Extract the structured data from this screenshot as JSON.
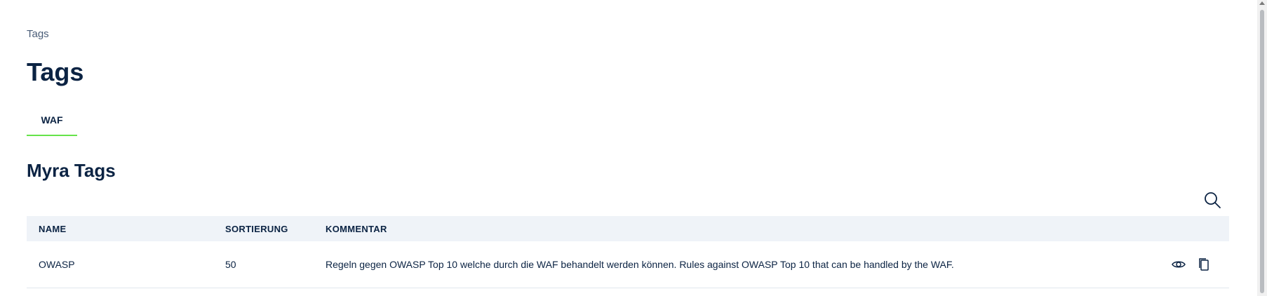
{
  "breadcrumb": "Tags",
  "page_title": "Tags",
  "tabs": [
    {
      "label": "WAF",
      "active": true
    }
  ],
  "section_title": "Myra Tags",
  "search_icon": "search-icon",
  "table": {
    "columns": [
      "NAME",
      "SORTIERUNG",
      "KOMMENTAR"
    ],
    "rows": [
      {
        "name": "OWASP",
        "sortierung": "50",
        "kommentar": "Regeln gegen OWASP Top 10 welche durch die WAF behandelt werden können. Rules against OWASP Top 10 that can be handled by the WAF.",
        "actions": [
          "eye-icon",
          "copy-icon"
        ]
      }
    ]
  },
  "colors": {
    "text_primary": "#0b2343",
    "tab_underline": "#66e34a",
    "table_header_bg": "#eff3f8"
  }
}
